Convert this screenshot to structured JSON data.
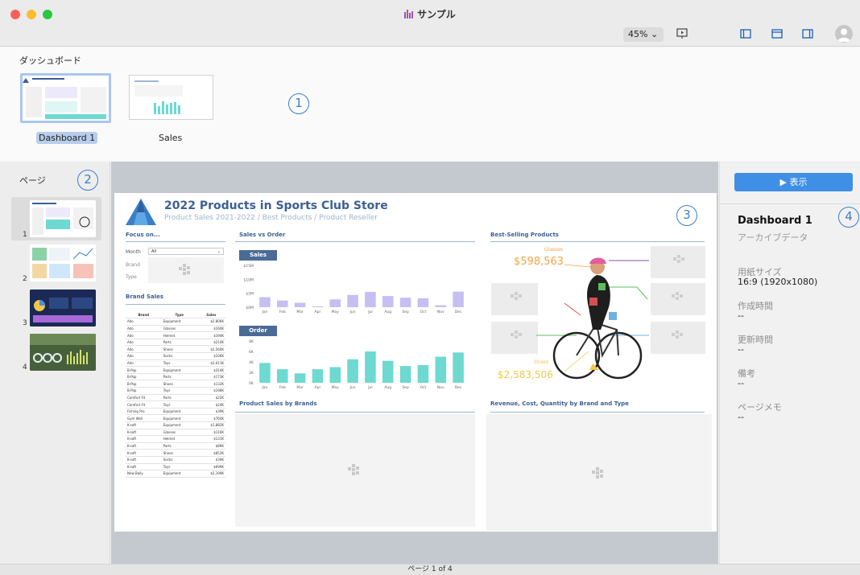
{
  "window": {
    "title": "サンプル",
    "zoom": "45% ⌄",
    "colors": {
      "close": "#ff5f57",
      "minimize": "#febc2e",
      "maximize": "#28c840",
      "accent": "#3f8fe6"
    }
  },
  "dashboards": {
    "heading": "ダッシュボード",
    "items": [
      {
        "label": "Dashboard 1",
        "selected": true
      },
      {
        "label": "Sales",
        "selected": false
      }
    ],
    "callout": "1"
  },
  "pages": {
    "heading": "ページ",
    "callout": "2",
    "items": [
      {
        "number": "1",
        "selected": true
      },
      {
        "number": "2",
        "selected": false
      },
      {
        "number": "3",
        "selected": false
      },
      {
        "number": "4",
        "selected": false
      }
    ]
  },
  "canvas": {
    "callout": "3",
    "sheet": {
      "title": "2022 Products in Sports Club Store",
      "subtitle": "Product Sales 2021-2022 / Best Products / Product Reseller",
      "focus_heading": "Focus on...",
      "filters": [
        {
          "label": "Month",
          "value": "All"
        },
        {
          "label": "Brand",
          "value": ""
        },
        {
          "label": "Type",
          "value": ""
        }
      ],
      "brand_sales_heading": "Brand Sales",
      "sales_vs_order_heading": "Sales vs Order",
      "best_selling_heading": "Best-Selling Products",
      "product_sales_by_brands_heading": "Product Sales by Brands",
      "revenue_heading": "Revenue, Cost, Quantity by Brand and Type",
      "best_selling": {
        "top_label": "Glasses",
        "top_value": "$598,563",
        "bottom_label": "Shoes",
        "bottom_value": "$2,583,506"
      },
      "brand_table": {
        "headers": [
          "Brand",
          "Type",
          "Sales"
        ],
        "rows": [
          [
            "Ado",
            "Equipment",
            "$2,806K"
          ],
          [
            "Ado",
            "Glasses",
            "$160K"
          ],
          [
            "Ado",
            "Helmet",
            "$194K"
          ],
          [
            "Ado",
            "Parts",
            "$210K"
          ],
          [
            "Ado",
            "Shoes",
            "$2,560K"
          ],
          [
            "Ado",
            "Socks",
            "$336K"
          ],
          [
            "Ado",
            "Toys",
            "$2,611K"
          ],
          [
            "B-Pop",
            "Equipment",
            "$314K"
          ],
          [
            "B-Pop",
            "Parts",
            "$173K"
          ],
          [
            "B-Pop",
            "Shoes",
            "$132K"
          ],
          [
            "B-Pop",
            "Toys",
            "$198K"
          ],
          [
            "Comfort Fit",
            "Parts",
            "$22K"
          ],
          [
            "Comfort Fit",
            "Toys",
            "$24K"
          ],
          [
            "Fishing Pro",
            "Equipment",
            "$39K"
          ],
          [
            "Gym Well",
            "Equipment",
            "$760K"
          ],
          [
            "K-soft",
            "Equipment",
            "$1,882K"
          ],
          [
            "K-soft",
            "Glasses",
            "$116K"
          ],
          [
            "K-soft",
            "Helmet",
            "$131K"
          ],
          [
            "K-soft",
            "Parts",
            "$86K"
          ],
          [
            "K-soft",
            "Shoes",
            "$853K"
          ],
          [
            "K-soft",
            "Socks",
            "$39K"
          ],
          [
            "K-soft",
            "Toys",
            "$699K"
          ],
          [
            "New Baily",
            "Equipment",
            "$2,199K"
          ]
        ]
      }
    }
  },
  "chart_data": [
    {
      "type": "bar",
      "title": "Sales",
      "categories": [
        "Jan",
        "Feb",
        "Mar",
        "Apr",
        "May",
        "Jun",
        "Jul",
        "Aug",
        "Sep",
        "Oct",
        "Nov",
        "Dec"
      ],
      "values": [
        3.6,
        2.4,
        1.6,
        0.3,
        2.8,
        4.4,
        5.5,
        4.0,
        3.4,
        3.2,
        0.7,
        5.6
      ],
      "ytick_labels": [
        "$15M",
        "$10M",
        "$5M",
        "$0M"
      ],
      "ylim": [
        0,
        15
      ],
      "color": "#c5bff2"
    },
    {
      "type": "bar",
      "title": "Order",
      "categories": [
        "Jan",
        "Feb",
        "Mar",
        "Apr",
        "May",
        "Jun",
        "Jul",
        "Aug",
        "Sep",
        "Oct",
        "Nov",
        "Dec"
      ],
      "values": [
        3.8,
        2.6,
        1.8,
        2.6,
        3.0,
        4.5,
        6.0,
        4.2,
        3.2,
        3.4,
        5.0,
        5.8
      ],
      "ytick_labels": [
        "8K",
        "6K",
        "4K",
        "2K",
        "0K"
      ],
      "ylim": [
        0,
        8
      ],
      "color": "#6dd9d1"
    }
  ],
  "properties": {
    "callout": "4",
    "show_button": "▶ 表示",
    "title": "Dashboard 1",
    "subtitle": "アーカイブデータ",
    "fields": [
      {
        "label": "用紙サイズ",
        "value": "16:9 (1920x1080)"
      },
      {
        "label": "作成時間",
        "value": "--"
      },
      {
        "label": "更新時間",
        "value": "--"
      },
      {
        "label": "備考",
        "value": "--"
      },
      {
        "label": "ページメモ",
        "value": "--"
      }
    ]
  },
  "status_bar": {
    "text": "ページ 1 of 4"
  }
}
